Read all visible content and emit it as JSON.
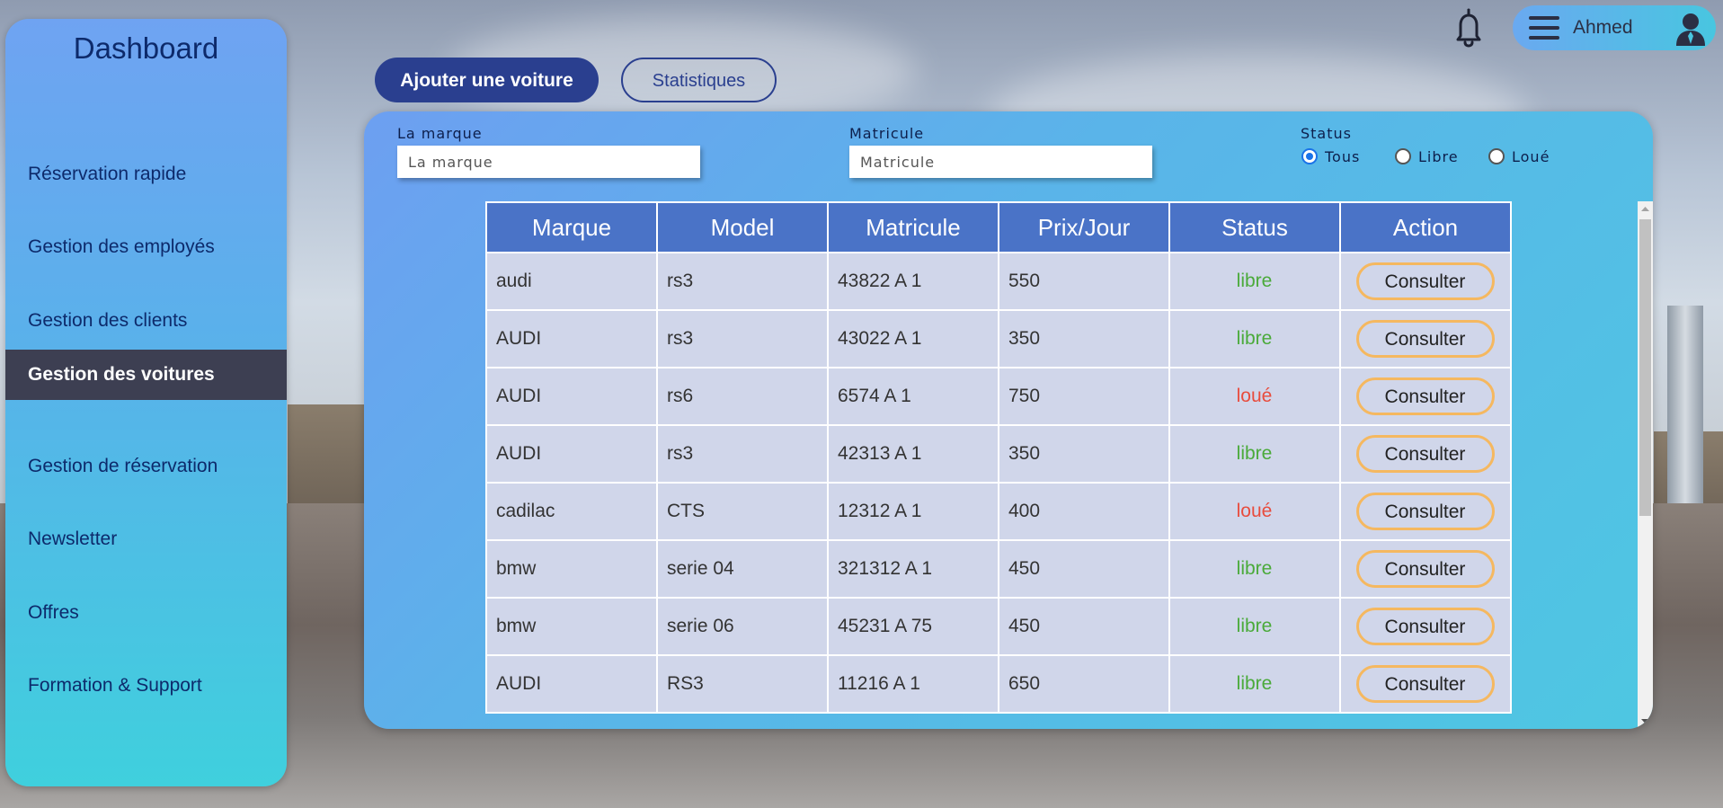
{
  "colors": {
    "sidebar_active_bg": "#3d3f52",
    "primary_button": "#2a3f8f",
    "table_header": "#4a73c7",
    "table_cell": "#d0d6ea",
    "status_libre": "#4aaa3a",
    "status_loue": "#e84c3d",
    "consult_border": "#f5b860"
  },
  "sidebar": {
    "title": "Dashboard",
    "items": [
      {
        "label": "Réservation rapide",
        "active": false
      },
      {
        "label": "Gestion des employés",
        "active": false
      },
      {
        "label": "Gestion des clients",
        "active": false
      },
      {
        "label": "Gestion des voitures",
        "active": true
      },
      {
        "label": "Gestion de réservation",
        "active": false
      },
      {
        "label": "Newsletter",
        "active": false
      },
      {
        "label": "Offres",
        "active": false
      },
      {
        "label": "Formation & Support",
        "active": false
      }
    ]
  },
  "toolbar": {
    "add_label": "Ajouter une voiture",
    "stats_label": "Statistiques"
  },
  "header": {
    "user_name": "Ahmed",
    "bell_icon": "bell-icon",
    "menu_icon": "hamburger-icon",
    "avatar_icon": "user-avatar-icon"
  },
  "filters": {
    "brand_label": "La marque",
    "brand_placeholder": "La marque",
    "brand_value": "",
    "plate_label": "Matricule",
    "plate_placeholder": "Matricule",
    "plate_value": "",
    "status_label": "Status",
    "status_options": [
      "Tous",
      "Libre",
      "Loué"
    ],
    "status_selected": "Tous"
  },
  "table": {
    "columns": [
      "Marque",
      "Model",
      "Matricule",
      "Prix/Jour",
      "Status",
      "Action"
    ],
    "rows": [
      {
        "marque": "audi",
        "model": "rs3",
        "matricule": "43822 A 1",
        "prix": "550",
        "status": "libre",
        "action": "Consulter"
      },
      {
        "marque": "AUDI",
        "model": "rs3",
        "matricule": "43022 A 1",
        "prix": "350",
        "status": "libre",
        "action": "Consulter"
      },
      {
        "marque": "AUDI",
        "model": "rs6",
        "matricule": "6574 A 1",
        "prix": "750",
        "status": "loué",
        "action": "Consulter"
      },
      {
        "marque": "AUDI",
        "model": "rs3",
        "matricule": "42313 A 1",
        "prix": "350",
        "status": "libre",
        "action": "Consulter"
      },
      {
        "marque": "cadilac",
        "model": "CTS",
        "matricule": "12312 A 1",
        "prix": "400",
        "status": "loué",
        "action": "Consulter"
      },
      {
        "marque": "bmw",
        "model": "serie 04",
        "matricule": "321312 A 1",
        "prix": "450",
        "status": "libre",
        "action": "Consulter"
      },
      {
        "marque": "bmw",
        "model": "serie 06",
        "matricule": "45231 A 75",
        "prix": "450",
        "status": "libre",
        "action": "Consulter"
      },
      {
        "marque": "AUDI",
        "model": "RS3",
        "matricule": "11216 A 1",
        "prix": "650",
        "status": "libre",
        "action": "Consulter"
      }
    ]
  }
}
